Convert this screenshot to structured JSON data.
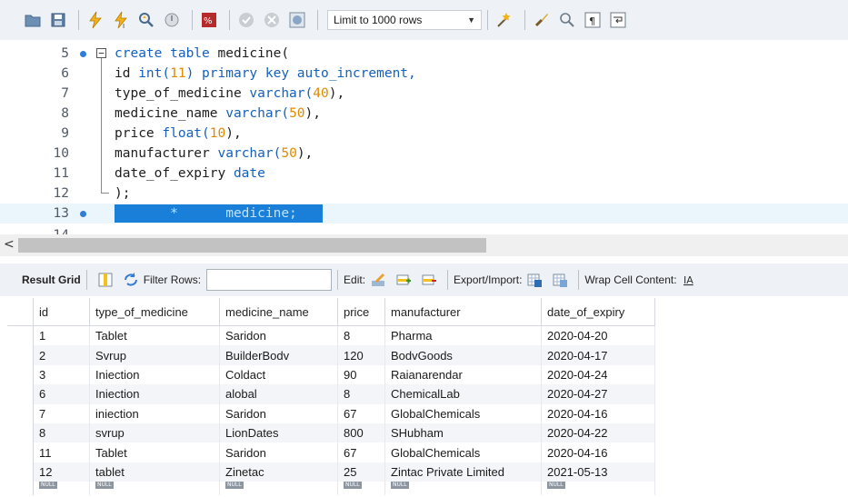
{
  "toolbar": {
    "limit_label": "Limit to 1000 rows",
    "icons": [
      "open-folder-icon",
      "save-icon",
      "execute-icon",
      "execute-current-icon",
      "explain-icon",
      "stop-icon",
      "toggle-output-icon",
      "commit-icon",
      "rollback-icon",
      "autocommit-icon",
      "beautify-icon",
      "find-icon",
      "invisible-chars-icon",
      "wrap-icon"
    ]
  },
  "editor": {
    "lines": [
      {
        "num": "5",
        "dot": true
      },
      {
        "num": "6"
      },
      {
        "num": "7"
      },
      {
        "num": "8"
      },
      {
        "num": "9"
      },
      {
        "num": "10"
      },
      {
        "num": "11"
      },
      {
        "num": "12"
      },
      {
        "num": "13",
        "dot": true
      },
      {
        "num": "14"
      }
    ],
    "code": {
      "l5_kw": "create table ",
      "l5_plain": "medicine(",
      "l6_a": "id ",
      "l6_kw": "int(",
      "l6_num": "11",
      "l6_b": ") primary key auto_increment,",
      "l7_a": "type_of_medicine ",
      "l7_kw": "varchar(",
      "l7_num": "40",
      "l7_b": "),",
      "l8_a": "medicine_name ",
      "l8_kw": "varchar(",
      "l8_num": "50",
      "l8_b": "),",
      "l9_a": "price ",
      "l9_kw": "float(",
      "l9_num": "10",
      "l9_b": "),",
      "l10_a": "manufacturer ",
      "l10_kw": "varchar(",
      "l10_num": "50",
      "l10_b": "),",
      "l11_a": "date_of_expiry ",
      "l11_kw": "date",
      "l12": ");",
      "l13_sel": "       *      medicine;"
    }
  },
  "result_toolbar": {
    "result_grid": "Result Grid",
    "filter_rows": "Filter Rows:",
    "edit": "Edit:",
    "export_import": "Export/Import:",
    "wrap_cell": "Wrap Cell Content:"
  },
  "grid": {
    "columns": [
      "id",
      "type_of_medicine",
      "medicine_name",
      "price",
      "manufacturer",
      "date_of_expiry"
    ],
    "rows": [
      [
        "1",
        "Tablet",
        "Saridon",
        "8",
        "Pharma",
        "2020-04-20"
      ],
      [
        "2",
        "Svrup",
        "BuilderBodv",
        "120",
        "BodvGoods",
        "2020-04-17"
      ],
      [
        "3",
        "Iniection",
        "Coldact",
        "90",
        "Raianarendar",
        "2020-04-24"
      ],
      [
        "6",
        "Iniection",
        "alobal",
        "8",
        "ChemicalLab",
        "2020-04-27"
      ],
      [
        "7",
        "iniection",
        "Saridon",
        "67",
        "GlobalChemicals",
        "2020-04-16"
      ],
      [
        "8",
        "svrup",
        "LionDates",
        "800",
        "SHubham",
        "2020-04-22"
      ],
      [
        "11",
        "Tablet",
        "Saridon",
        "67",
        "GlobalChemicals",
        "2020-04-16"
      ],
      [
        "12",
        "tablet",
        "Zinetac",
        "25",
        "Zintac Private Limited",
        "2021-05-13"
      ]
    ],
    "null_label": "NULL"
  },
  "colors": {
    "keyword": "#1560bd",
    "number": "#e08a00",
    "selection": "#1a7fd9",
    "breakpoint": "#2f7dd6"
  }
}
